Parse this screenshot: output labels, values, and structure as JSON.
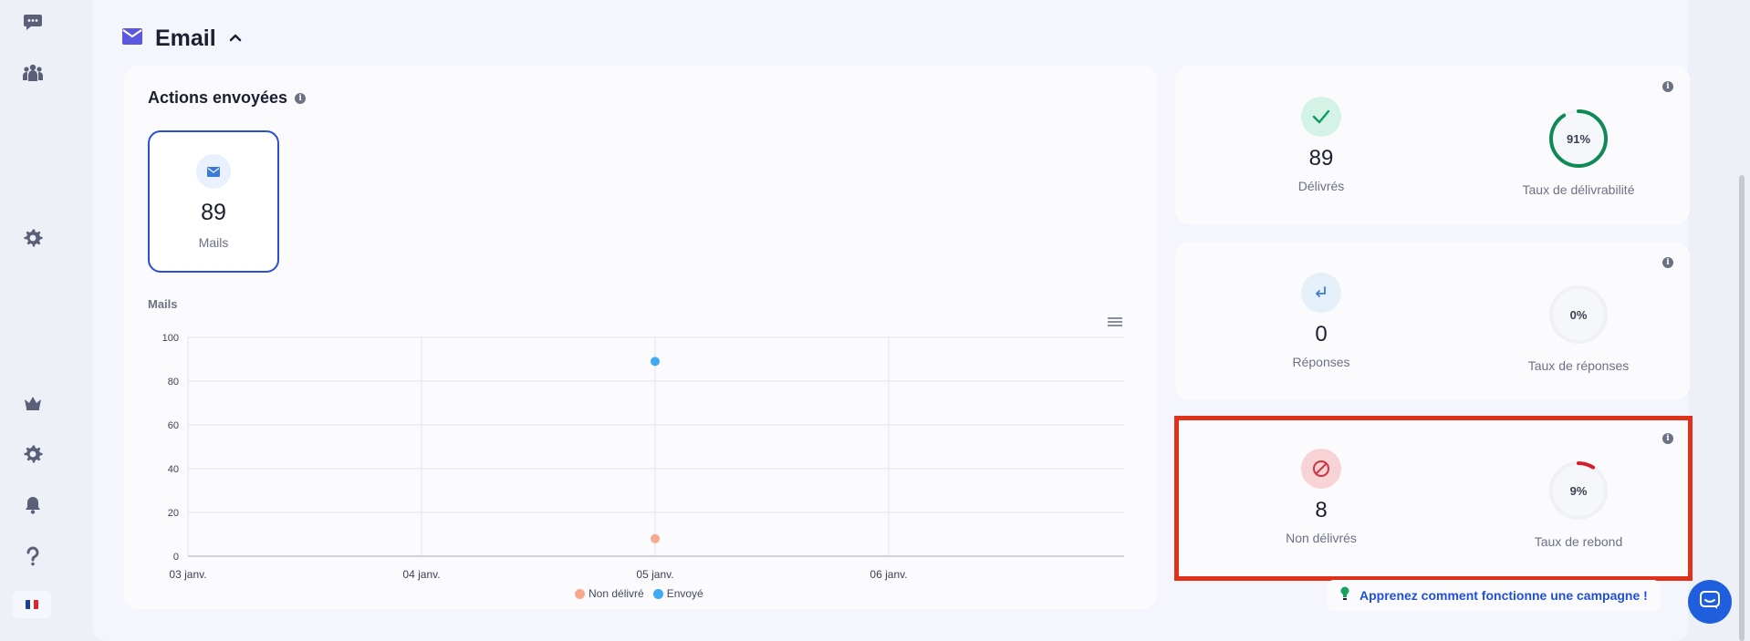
{
  "sidebar": {
    "icons": [
      "chat-bubble-icon",
      "team-icon",
      "gear-icon",
      "crown-icon",
      "gear-icon",
      "bell-icon",
      "question-icon"
    ],
    "language_flag": "fr-flag"
  },
  "section": {
    "title": "Email",
    "icon": "envelope-icon",
    "toggle_icon": "chevron-up-icon"
  },
  "actions": {
    "title": "Actions envoyées",
    "tile": {
      "value": "89",
      "label": "Mails"
    }
  },
  "chart_data": {
    "type": "scatter",
    "title": "Mails",
    "x_categories": [
      "03 janv.",
      "04 janv.",
      "05 janv.",
      "06 janv."
    ],
    "ylim": [
      0,
      100
    ],
    "y_ticks": [
      "100",
      "80",
      "60",
      "40",
      "20",
      "0"
    ],
    "grid": true,
    "legend_position": "bottom",
    "series": [
      {
        "name": "Non délivré",
        "color": "#f7a98f",
        "points": [
          {
            "x": "05 janv.",
            "y": 8
          }
        ]
      },
      {
        "name": "Envoyé",
        "color": "#3fa9f5",
        "points": [
          {
            "x": "05 janv.",
            "y": 89
          }
        ]
      }
    ]
  },
  "stats": [
    {
      "badge_icon": "check-icon",
      "badge_color": "#d4f3e6",
      "icon_color": "#0f9d63",
      "value": "89",
      "label": "Délivrés",
      "rate_label": "Taux de délivrabilité",
      "rate_text": "91%",
      "rate_value": 0.91,
      "rate_color": "#0f8a57"
    },
    {
      "badge_icon": "reply-arrow-icon",
      "badge_color": "#e6f0fb",
      "icon_color": "#3a7bd5",
      "value": "0",
      "label": "Réponses",
      "rate_label": "Taux de réponses",
      "rate_text": "0%",
      "rate_value": 0,
      "rate_color": "#3a7bd5"
    },
    {
      "badge_icon": "blocked-icon",
      "badge_color": "#f7d3d6",
      "icon_color": "#d2333f",
      "value": "8",
      "label": "Non délivrés",
      "rate_label": "Taux de rebond",
      "rate_text": "9%",
      "rate_value": 0.09,
      "rate_color": "#d21f2c"
    }
  ],
  "learn_link": {
    "icon": "lightbulb-icon",
    "text": "Apprenez comment fonctionne une campagne !"
  },
  "chat_button": {
    "icon": "chat-icon"
  },
  "colors": {
    "accent": "#2b4fd1",
    "highlight": "#e0321b"
  }
}
